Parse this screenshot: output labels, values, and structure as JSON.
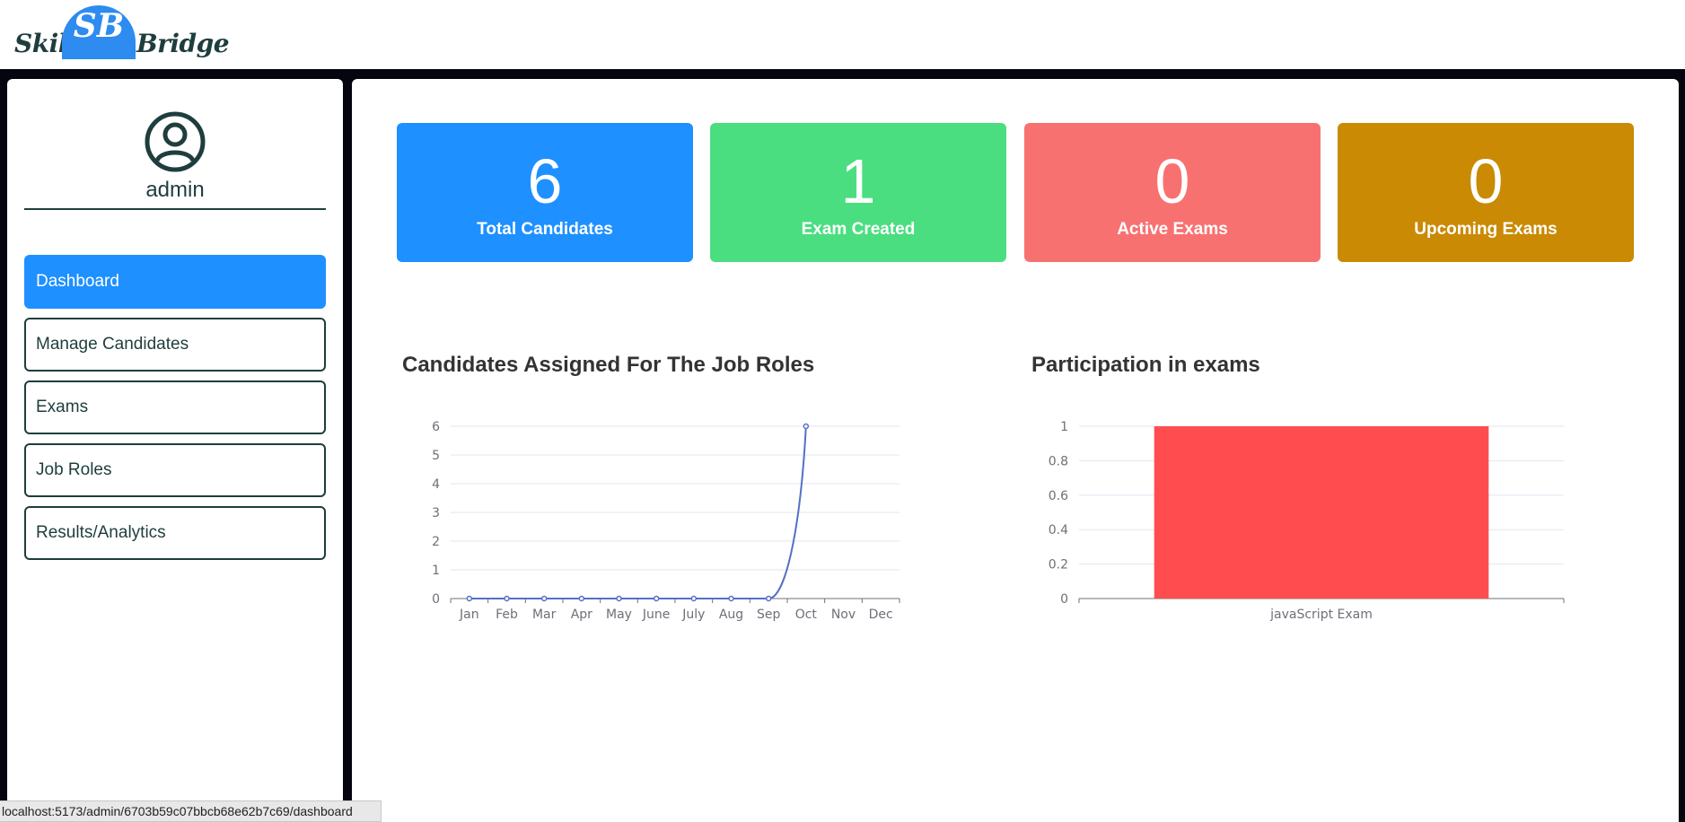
{
  "brand": {
    "left": "Skill",
    "badge": "SB",
    "right": "Bridge",
    "badge_color": "#2e8bf0"
  },
  "profile": {
    "name": "admin",
    "icon": "user-circle-icon"
  },
  "nav": {
    "items": [
      {
        "label": "Dashboard",
        "active": true
      },
      {
        "label": "Manage Candidates",
        "active": false
      },
      {
        "label": "Exams",
        "active": false
      },
      {
        "label": "Job Roles",
        "active": false
      },
      {
        "label": "Results/Analytics",
        "active": false
      }
    ],
    "active_color": "#1e90ff"
  },
  "stats": [
    {
      "value": "6",
      "label": "Total Candidates",
      "color": "#1e90ff"
    },
    {
      "value": "1",
      "label": "Exam Created",
      "color": "#4ade80"
    },
    {
      "value": "0",
      "label": "Active Exams",
      "color": "#f87171"
    },
    {
      "value": "0",
      "label": "Upcoming Exams",
      "color": "#ca8a04"
    }
  ],
  "chart_data": [
    {
      "type": "line",
      "title": "Candidates Assigned For The Job Roles",
      "categories": [
        "Jan",
        "Feb",
        "Mar",
        "Apr",
        "May",
        "June",
        "July",
        "Aug",
        "Sep",
        "Oct",
        "Nov",
        "Dec"
      ],
      "series": [
        {
          "values": [
            0,
            0,
            0,
            0,
            0,
            0,
            0,
            0,
            0,
            6,
            null,
            null
          ],
          "color": "#5470c6"
        }
      ],
      "ylim": [
        0,
        6
      ],
      "yticks": [
        "0",
        "1",
        "2",
        "3",
        "4",
        "5",
        "6"
      ],
      "grid": true
    },
    {
      "type": "bar",
      "title": "Participation in exams",
      "categories": [
        "javaScript Exam"
      ],
      "series": [
        {
          "values": [
            1
          ],
          "color": "#ff4d4f"
        }
      ],
      "ylim": [
        0,
        1
      ],
      "yticks": [
        "0",
        "0.2",
        "0.4",
        "0.6",
        "0.8",
        "1"
      ],
      "grid": true
    }
  ],
  "status_bar": {
    "url": "localhost:5173/admin/6703b59c07bbcb68e62b7c69/dashboard"
  }
}
